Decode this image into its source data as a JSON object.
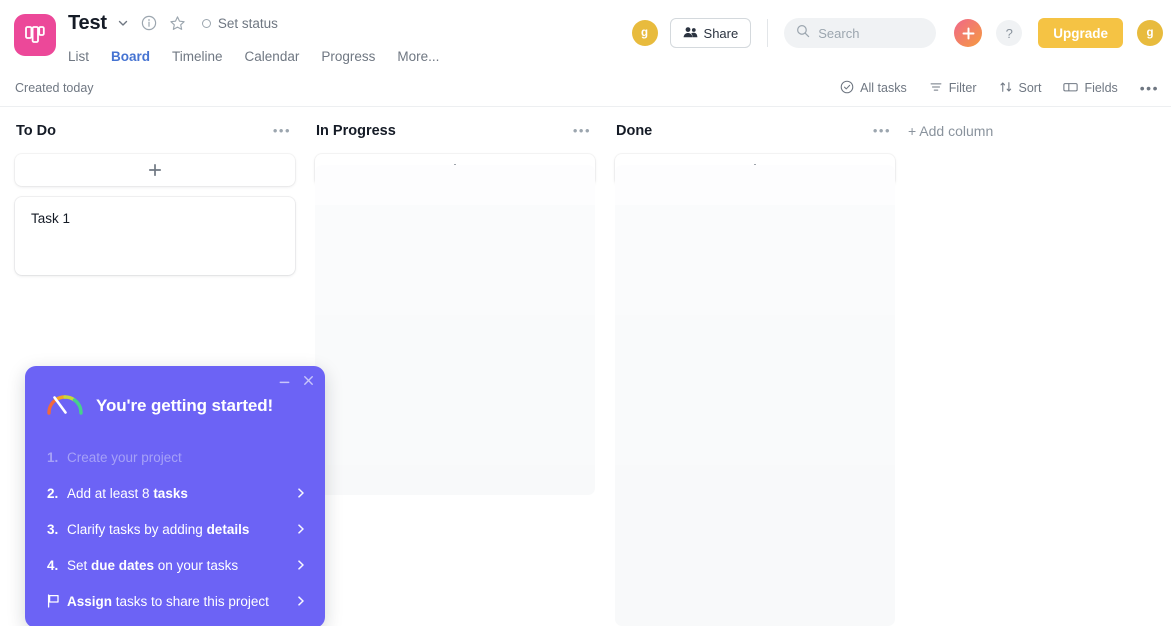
{
  "header": {
    "logo_icon": "board-logo-icon",
    "project_title": "Test",
    "chevron_icon": "chevron-down-icon",
    "info_icon": "info-circle-icon",
    "star_icon": "star-outline-icon",
    "set_status_label": "Set status",
    "tabs": [
      {
        "label": "List",
        "active": false
      },
      {
        "label": "Board",
        "active": true
      },
      {
        "label": "Timeline",
        "active": false
      },
      {
        "label": "Calendar",
        "active": false
      },
      {
        "label": "Progress",
        "active": false
      },
      {
        "label": "More...",
        "active": false
      }
    ],
    "avatar_left": "g",
    "share_label": "Share",
    "search_placeholder": "Search",
    "search_value": "",
    "plus_label": "+",
    "help_label": "?",
    "upgrade_label": "Upgrade",
    "avatar_right": "g"
  },
  "toolbar": {
    "created_label": "Created today",
    "all_tasks_label": "All tasks",
    "filter_label": "Filter",
    "sort_label": "Sort",
    "fields_label": "Fields",
    "overflow_label": "•••"
  },
  "board": {
    "add_column_label": "+ Add column",
    "columns": [
      {
        "title": "To Do",
        "menu_label": "•••",
        "cards": [
          {
            "title": "Task 1"
          }
        ]
      },
      {
        "title": "In Progress",
        "menu_label": "•••",
        "cards": []
      },
      {
        "title": "Done",
        "menu_label": "•••",
        "cards": []
      }
    ]
  },
  "onboarding": {
    "title": "You're getting started!",
    "gauge_icon": "gauge-icon",
    "minimize_label": "—",
    "close_label": "×",
    "items": [
      {
        "num": "1.",
        "prefix": "",
        "bold": "",
        "suffix": "Create your project",
        "done": true,
        "arrow": false
      },
      {
        "num": "2.",
        "prefix": "Add at least 8 ",
        "bold": "tasks",
        "suffix": "",
        "done": false,
        "arrow": true
      },
      {
        "num": "3.",
        "prefix": "Clarify tasks by adding ",
        "bold": "details",
        "suffix": "",
        "done": false,
        "arrow": true
      },
      {
        "num": "4.",
        "prefix": "Set ",
        "bold": "due dates",
        "suffix": " on your tasks",
        "done": false,
        "arrow": true
      },
      {
        "num": "flag",
        "prefix": "",
        "bold": "Assign",
        "suffix": " tasks to share this project",
        "done": false,
        "arrow": true
      }
    ]
  },
  "colors": {
    "accent_blue": "#4573d2",
    "logo_pink": "#ec4899",
    "upgrade_yellow": "#f5c344",
    "onboard_purple": "#6c63f5",
    "avatar_gold": "#e8bb3d"
  }
}
